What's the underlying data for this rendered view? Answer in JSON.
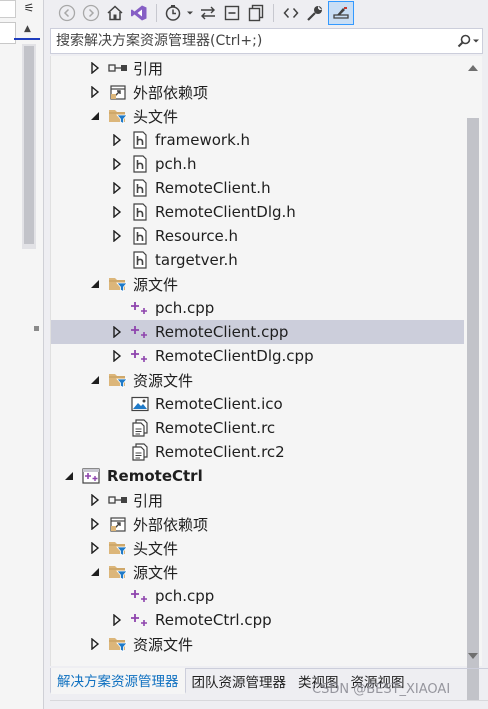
{
  "search": {
    "placeholder": "搜索解决方案资源管理器(Ctrl+;)"
  },
  "toolbar": {
    "buttons": [
      "back-icon",
      "forward-icon",
      "home-icon",
      "vs-switch-views-icon",
      "pending-changes-icon",
      "dropdown-arrow-icon",
      "sync-icon",
      "collapse-all-icon",
      "show-all-files-icon",
      "view-code-icon",
      "properties-icon",
      "preview-icon"
    ]
  },
  "left_strip": {
    "button": "⚟"
  },
  "tree": {
    "items": [
      {
        "label": "引用",
        "icon": "references-icon",
        "expander": "collapsed"
      },
      {
        "label": "外部依赖项",
        "icon": "external-deps-icon",
        "expander": "collapsed"
      },
      {
        "label": "头文件",
        "icon": "filter-folder-icon",
        "expander": "expanded"
      },
      {
        "label": "framework.h",
        "icon": "header-file-icon",
        "expander": "collapsed"
      },
      {
        "label": "pch.h",
        "icon": "header-file-icon",
        "expander": "collapsed"
      },
      {
        "label": "RemoteClient.h",
        "icon": "header-file-icon",
        "expander": "collapsed"
      },
      {
        "label": "RemoteClientDlg.h",
        "icon": "header-file-icon",
        "expander": "collapsed"
      },
      {
        "label": "Resource.h",
        "icon": "header-file-icon",
        "expander": "collapsed"
      },
      {
        "label": "targetver.h",
        "icon": "header-file-icon",
        "expander": "none"
      },
      {
        "label": "源文件",
        "icon": "filter-folder-icon",
        "expander": "expanded"
      },
      {
        "label": "pch.cpp",
        "icon": "cpp-file-icon",
        "expander": "none"
      },
      {
        "label": "RemoteClient.cpp",
        "icon": "cpp-file-icon",
        "expander": "collapsed",
        "selected": true
      },
      {
        "label": "RemoteClientDlg.cpp",
        "icon": "cpp-file-icon",
        "expander": "collapsed"
      },
      {
        "label": "资源文件",
        "icon": "filter-folder-icon",
        "expander": "expanded"
      },
      {
        "label": "RemoteClient.ico",
        "icon": "image-file-icon",
        "expander": "none"
      },
      {
        "label": "RemoteClient.rc",
        "icon": "resource-file-icon",
        "expander": "none"
      },
      {
        "label": "RemoteClient.rc2",
        "icon": "resource-file-icon",
        "expander": "none"
      },
      {
        "label": "RemoteCtrl",
        "icon": "project-icon",
        "expander": "expanded",
        "bold": true
      },
      {
        "label": "引用",
        "icon": "references-icon",
        "expander": "collapsed"
      },
      {
        "label": "外部依赖项",
        "icon": "external-deps-icon",
        "expander": "collapsed"
      },
      {
        "label": "头文件",
        "icon": "filter-folder-icon",
        "expander": "collapsed"
      },
      {
        "label": "源文件",
        "icon": "filter-folder-icon",
        "expander": "expanded"
      },
      {
        "label": "pch.cpp",
        "icon": "cpp-file-icon",
        "expander": "none"
      },
      {
        "label": "RemoteCtrl.cpp",
        "icon": "cpp-file-icon",
        "expander": "collapsed"
      },
      {
        "label": "资源文件",
        "icon": "filter-folder-icon",
        "expander": "collapsed"
      }
    ]
  },
  "tabs": [
    {
      "label": "解决方案资源管理器",
      "active": true
    },
    {
      "label": "团队资源管理器"
    },
    {
      "label": "类视图"
    },
    {
      "label": "资源视图"
    }
  ],
  "watermark": "CSDN @BEST_XIAOAI",
  "colors": {
    "accent": "#0e70c0",
    "selection": "#cccedb",
    "background": "#f5f5f5",
    "cpp_icon": "#8e44ad",
    "folder": "#dcb67a"
  }
}
